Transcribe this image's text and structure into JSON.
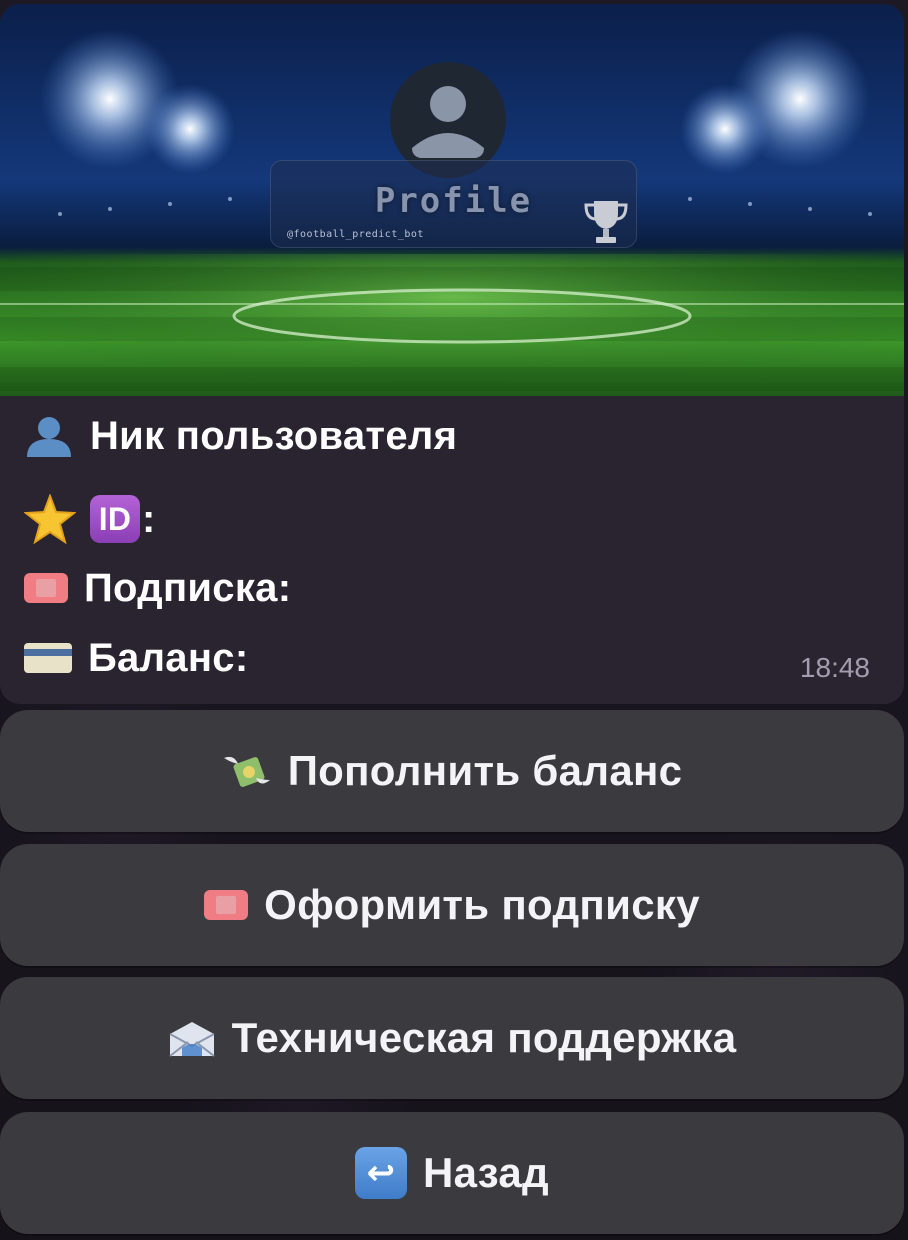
{
  "banner": {
    "title": "Profile",
    "handle": "@football_predict_bot"
  },
  "profile": {
    "nickname_label": "Ник пользователя",
    "id_glyph": "ID",
    "id_suffix": ":",
    "subscription_label": "Подписка:",
    "balance_label": "Баланс:",
    "time": "18:48"
  },
  "buttons": {
    "top_up": "Пополнить баланс",
    "subscribe": "Оформить подписку",
    "support": "Техническая поддержка",
    "back": "Назад"
  },
  "icons": {
    "user": "bust-in-silhouette-icon",
    "star": "star-icon",
    "id": "id-button-icon",
    "ticket": "admission-ticket-icon",
    "card": "credit-card-icon",
    "money": "money-with-wings-icon",
    "mail": "incoming-envelope-icon",
    "back": "return-arrow-icon",
    "trophy": "trophy-icon",
    "avatar": "avatar-icon"
  },
  "colors": {
    "bubble": "#2a2430",
    "button": "#3b3a3f",
    "timestamp": "#a69cb0"
  }
}
